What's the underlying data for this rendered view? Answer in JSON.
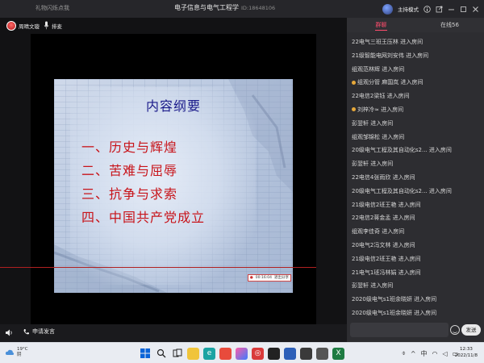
{
  "titlebar": {
    "left_note": "礼物闪烁点我",
    "title": "电子信息与电气工程学",
    "room_id": "ID:18648106",
    "mode": "主持模式"
  },
  "stage": {
    "host_label": "周晴文璇",
    "mic_label": "排麦",
    "apply_label": "申请发言"
  },
  "slide": {
    "title": "内容纲要",
    "items": [
      "一、历史与辉煌",
      "二、苦难与屈辱",
      "三、抗争与求索",
      "四、中国共产党成立"
    ],
    "tag_a": "00:16:04",
    "tag_b": "退出分享"
  },
  "panel": {
    "tabs": [
      "群聊",
      "在线56"
    ],
    "messages": [
      "22电气三班王压林 进入房间",
      "21级智能电网刘安伟 进入房间",
      "组观范林辉 进入房间",
      "组观分管 麻国岚 进入房间",
      "22电信2梁钰 进入房间",
      "刘梓冷≈ 进入房间",
      "彭翌轩 进入房间",
      "组观邹锦松 进入房间",
      "20级电气工程及其自动化s2... 进入房间",
      "彭翌轩 进入房间",
      "22电信4张雨欣 进入房间",
      "20级电气工程及其自动化s2... 进入房间",
      "21级电信2班王艳 进入房间",
      "22电信2蒋金孟 进入房间",
      "组观李佳奇 进入房间",
      "20电气2冯文林 进入房间",
      "21级电信2班王艳 进入房间",
      "21电气1班冯林娟 进入房间",
      "彭翌轩 进入房间",
      "2020级电气s1班余晓妍 进入房间",
      "2020级电气s1班余晓妍 进入房间"
    ],
    "send_label": "发送"
  },
  "taskbar": {
    "temp": "19°C",
    "weather": "阴",
    "time": "12:33",
    "date": "2022/11/8"
  },
  "colors": {
    "accent": "#ff4d6d",
    "slide_title": "#1a1a8a",
    "slide_items": "#c8141a"
  }
}
